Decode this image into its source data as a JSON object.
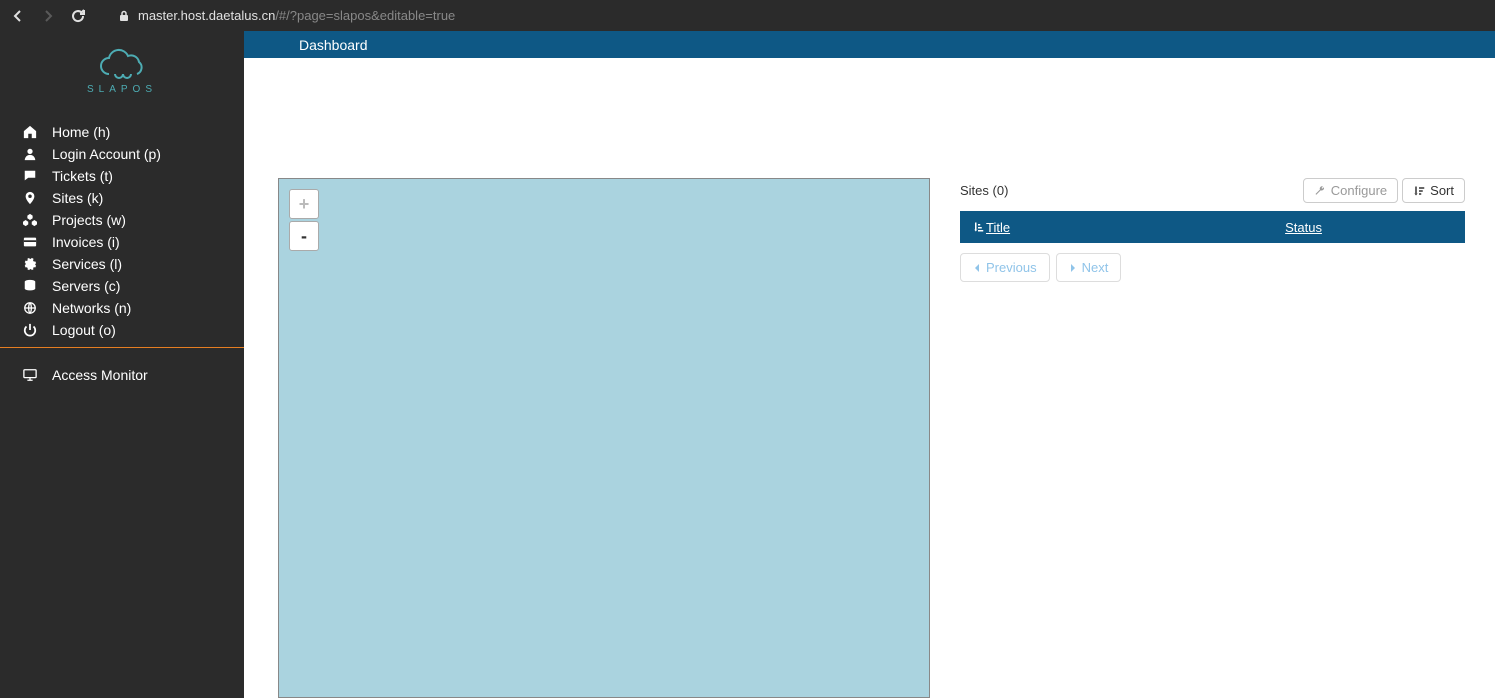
{
  "browser": {
    "url_host": "master.host.daetalus.cn",
    "url_path": "/#/?page=slapos&editable=true"
  },
  "logo": {
    "text": "SLAPOS"
  },
  "sidebar": {
    "items": [
      {
        "label": "Home (h)"
      },
      {
        "label": "Login Account (p)"
      },
      {
        "label": "Tickets (t)"
      },
      {
        "label": "Sites (k)"
      },
      {
        "label": "Projects (w)"
      },
      {
        "label": "Invoices (i)"
      },
      {
        "label": "Services (l)"
      },
      {
        "label": "Servers (c)"
      },
      {
        "label": "Networks (n)"
      },
      {
        "label": "Logout (o)"
      }
    ],
    "monitor": {
      "label": "Access Monitor"
    }
  },
  "header": {
    "title": "Dashboard"
  },
  "map": {
    "zoom_in": "+",
    "zoom_out": "-"
  },
  "sites": {
    "title": "Sites (0)",
    "configure_label": "Configure",
    "sort_label": "Sort",
    "columns": {
      "title": "Title",
      "status": "Status"
    },
    "rows": []
  },
  "pagination": {
    "previous": "Previous",
    "next": "Next"
  }
}
